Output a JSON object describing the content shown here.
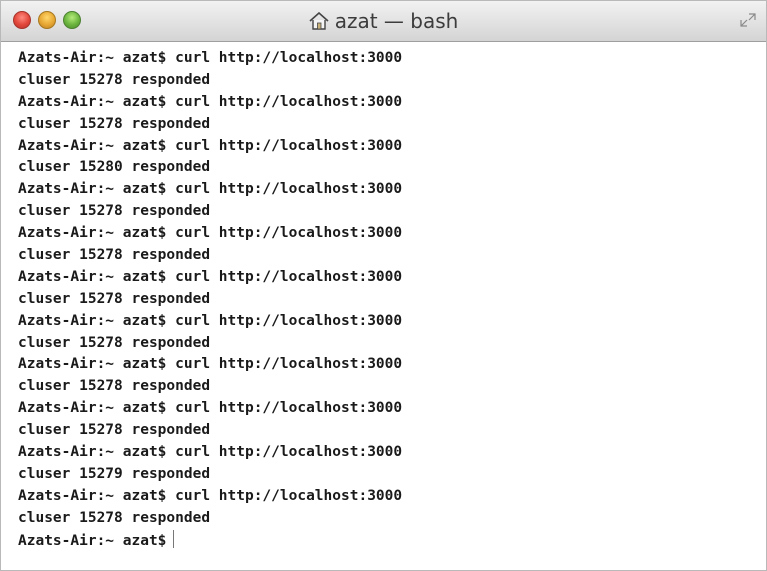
{
  "window": {
    "title": "azat — bash"
  },
  "terminal": {
    "lines": [
      "Azats-Air:~ azat$ curl http://localhost:3000",
      "cluser 15278 responded",
      "Azats-Air:~ azat$ curl http://localhost:3000",
      "cluser 15278 responded",
      "Azats-Air:~ azat$ curl http://localhost:3000",
      "cluser 15280 responded",
      "Azats-Air:~ azat$ curl http://localhost:3000",
      "cluser 15278 responded",
      "Azats-Air:~ azat$ curl http://localhost:3000",
      "cluser 15278 responded",
      "Azats-Air:~ azat$ curl http://localhost:3000",
      "cluser 15278 responded",
      "Azats-Air:~ azat$ curl http://localhost:3000",
      "cluser 15278 responded",
      "Azats-Air:~ azat$ curl http://localhost:3000",
      "cluser 15278 responded",
      "Azats-Air:~ azat$ curl http://localhost:3000",
      "cluser 15278 responded",
      "Azats-Air:~ azat$ curl http://localhost:3000",
      "cluser 15279 responded",
      "Azats-Air:~ azat$ curl http://localhost:3000",
      "cluser 15278 responded"
    ],
    "prompt": "Azats-Air:~ azat$"
  },
  "icons": {
    "close": "close-icon",
    "minimize": "minimize-icon",
    "zoom": "zoom-icon",
    "home": "home-icon",
    "fullscreen": "fullscreen-icon"
  }
}
